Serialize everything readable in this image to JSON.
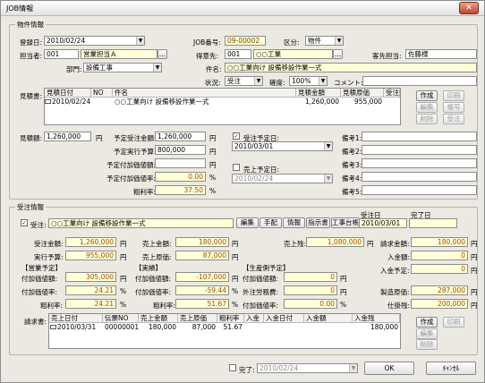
{
  "window": {
    "title": "JOB情報",
    "close": "✕"
  },
  "prop": {
    "group": "物件情報",
    "reg_date_label": "登録日:",
    "reg_date": "2010/02/24",
    "job_no_label": "JOB番号:",
    "job_no": "09-00002",
    "kubun_label": "区分:",
    "kubun": "物件",
    "tanto_label": "担当者:",
    "tanto_code": "001",
    "tanto_name": "営業担当Ａ",
    "tokui_label": "得意先:",
    "tokui_code": "001",
    "tokui_name": "○○工業",
    "kyaku_label": "客先担当:",
    "kyaku": "佐藤様",
    "bumon_label": "部門:",
    "bumon": "設備工事",
    "kenmei_label": "件名:",
    "kenmei": "○○工業向け 設備移設作業一式",
    "jokyo_label": "状況:",
    "jokyo": "受注",
    "kakudo_label": "確度:",
    "kakudo": "100%",
    "comment_label": "コメント:",
    "comment": "",
    "mitsu_label": "見積書:",
    "mitsu_headers": [
      "見積日付",
      "NO",
      "件名",
      "見積金額",
      "見積原価",
      "受注"
    ],
    "mitsu_rows": [
      [
        "2010/02/24",
        "",
        "○○工業向け 設備移設作業一式",
        "1,260,000",
        "955,000",
        ""
      ]
    ],
    "btns": {
      "create": "作成",
      "print": "印刷",
      "edit": "編集",
      "copy": "複写",
      "del": "削除",
      "order": "受注"
    },
    "mitsu_amt_label": "見積額:",
    "mitsu_amt": "1,260,000",
    "yen": "円",
    "yotei_juchu_label": "予定受注金額:",
    "yotei_juchu": "1,260,000",
    "yotei_jikko_label": "予定実行予算:",
    "yotei_jikko": "800,000",
    "yotei_fuka_label": "予定付加価値額:",
    "yotei_fuka": "",
    "yotei_fukaritsu_label": "予定付加価値率:",
    "yotei_fukaritsu": "0.00",
    "pct": "%",
    "arari_label": "粗利率:",
    "arari": "37.50",
    "juchu_yotei_label": "受注予定日:",
    "juchu_yotei": "2010/03/01",
    "uriage_yotei_label": "売上予定日:",
    "uriage_yotei": "2010/02/24",
    "biko": [
      "備考1:",
      "備考2:",
      "備考3:",
      "備考4:",
      "備考5:"
    ]
  },
  "order": {
    "group": "受注情報",
    "juchu_label": "受注:",
    "kenmei": "○○工業向け 設備移設作業一式",
    "tabs": [
      "編集",
      "手配",
      "情報",
      "指示書",
      "工事台帳"
    ],
    "juchubi_label": "受注日",
    "juchubi": "2010/03/01",
    "kanryo_label": "完了日",
    "kanryo": "",
    "juchu_kin_label": "受注金額:",
    "juchu_kin": "1,260,000",
    "uriage_kin_label": "売上金額:",
    "uriage_kin": "180,000",
    "uriage_zan_label": "売上残:",
    "uriage_zan": "1,080,000",
    "seikyu_kin_label": "請求金額:",
    "seikyu_kin": "180,000",
    "jikko_label": "実行予算:",
    "jikko": "955,000",
    "uriage_gen_label": "売上原価:",
    "uriage_gen": "87,000",
    "nyukin_label": "入金額:",
    "nyukin": "0",
    "nyukin_yotei_label": "入金予定:",
    "nyukin_yotei": "0",
    "eigyo_label": "【営業予定】",
    "jisseki_label": "【実績】",
    "seisan_label": "【生産側予定】",
    "fuka_label": "付加価値額:",
    "e_fuka": "305,000",
    "j_fuka": "-107,000",
    "s_fuka": "0",
    "fukaritsu_label": "付加価値率:",
    "e_fukaritsu": "24.21",
    "j_fukaritsu": "-59.44",
    "s_fukaritsu": "0",
    "arari_label": "粗利率:",
    "e_arari": "24.21",
    "j_arari": "51.67",
    "gaichu_label": "外注労務費:",
    "gaichu": "0",
    "s_fuka2_label": "付加価値率:",
    "s_fuka2": "0.00",
    "seizo_label": "製造原価:",
    "seizo": "287,000",
    "shikakari_label": "仕掛残:",
    "shikakari": "200,000",
    "seikyu_label": "請求書:",
    "seikyu_headers": [
      "売上日付",
      "伝票NO",
      "売上金額",
      "売上原価",
      "粗利率",
      "入金",
      "入金日付",
      "入金額",
      "入金残"
    ],
    "seikyu_rows": [
      [
        "2010/03/31",
        "00000001",
        "180,000",
        "87,000",
        "51.67",
        "",
        "",
        "",
        "180,000"
      ]
    ]
  },
  "footer": {
    "kanryo_chk": "完了:",
    "kanryo_date": "2010/02/24",
    "ok": "OK",
    "cancel": "ｷｬﾝｾﾙ"
  }
}
